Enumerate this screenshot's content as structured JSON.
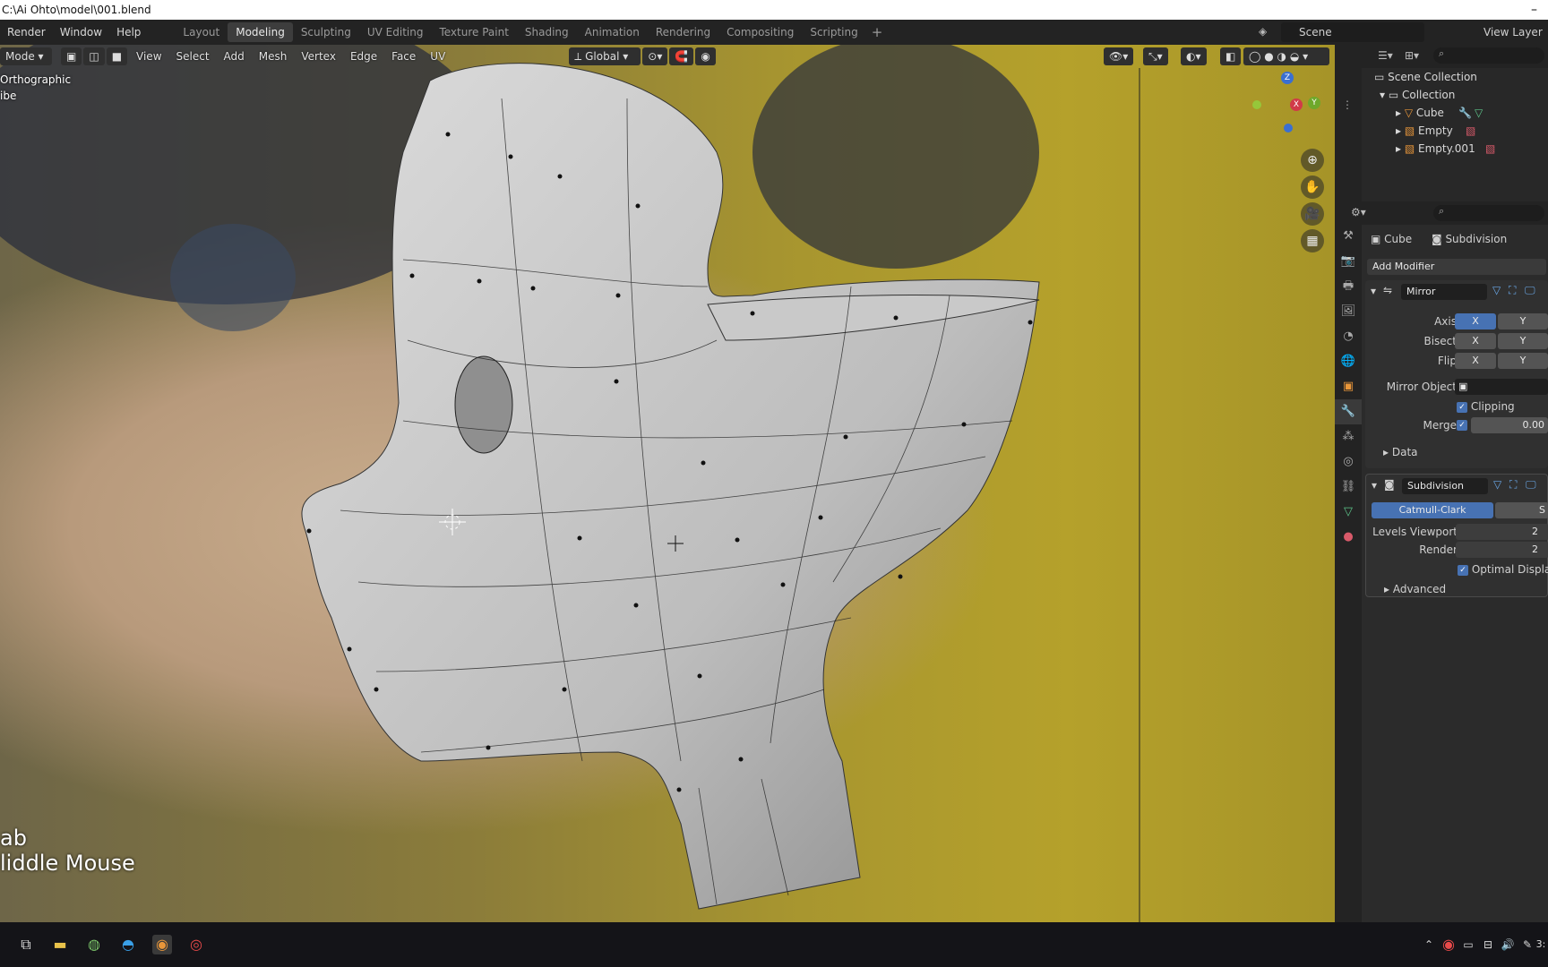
{
  "window": {
    "title": "C:\\Ai Ohto\\model\\001.blend",
    "minimize": "–"
  },
  "menu": [
    "Render",
    "Window",
    "Help"
  ],
  "workspaces": [
    "Layout",
    "Modeling",
    "Sculpting",
    "UV Editing",
    "Texture Paint",
    "Shading",
    "Animation",
    "Rendering",
    "Compositing",
    "Scripting"
  ],
  "active_workspace": "Modeling",
  "scene": "Scene",
  "view_layer": "View Layer",
  "viewport": {
    "mode": "Mode",
    "menus": [
      "View",
      "Select",
      "Add",
      "Mesh",
      "Vertex",
      "Edge",
      "Face",
      "UV"
    ],
    "transform": "Global",
    "view_name": "Orthographic",
    "object_name": "ibe",
    "hint_line1": "ab",
    "hint_line2": "liddle Mouse",
    "gizmo": {
      "z": "Z",
      "x": "X",
      "y": "Y"
    }
  },
  "outliner": {
    "root": "Scene Collection",
    "collection": "Collection",
    "items": [
      "Cube",
      "Empty",
      "Empty.001"
    ]
  },
  "properties": {
    "breadcrumb_object": "Cube",
    "breadcrumb_modifier": "Subdivision",
    "add_modifier": "Add Modifier",
    "mirror": {
      "name": "Mirror",
      "axis_label": "Axis",
      "bisect_label": "Bisect",
      "flip_label": "Flip",
      "x": "X",
      "y": "Y",
      "mirror_object_label": "Mirror Object",
      "clipping": "Clipping",
      "merge_label": "Merge",
      "merge_value": "0.00",
      "data": "Data"
    },
    "subdivision": {
      "name": "Subdivision",
      "catmull": "Catmull-Clark",
      "simple": "S",
      "levels_viewport_label": "Levels Viewport",
      "levels_viewport": "2",
      "render_label": "Render",
      "render": "2",
      "optimal": "Optimal Displa",
      "advanced": "Advanced"
    }
  },
  "taskbar": {
    "clock": "3:"
  }
}
